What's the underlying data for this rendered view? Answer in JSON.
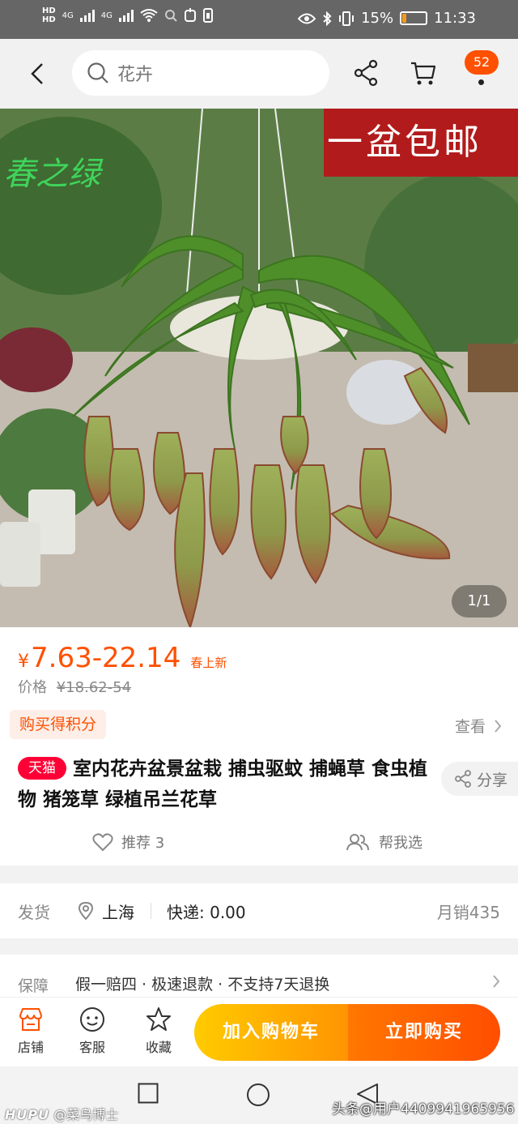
{
  "status_bar": {
    "hd1": "HD",
    "hd2": "HD",
    "net1": "4G",
    "net2": "4G",
    "battery_percent": "15%",
    "battery_level": 0.15,
    "time": "11:33"
  },
  "nav": {
    "search_placeholder": "花卉",
    "cart_badge": "52"
  },
  "hero": {
    "banner_text": "一盆包邮",
    "logo_text": "春之绿",
    "image_counter": "1/1"
  },
  "product": {
    "price_yen": "¥",
    "price": "7.63-22.14",
    "price_tag": "春上新",
    "orig_label": "价格",
    "orig_price": "¥18.62-54",
    "points_label": "购买得积分",
    "look_label": "查看",
    "tmall_badge": "天猫",
    "title": "室内花卉盆景盆栽 捕虫驱蚊 捕蝇草 食虫植物 猪笼草 绿植吊兰花草",
    "share_label": "分享",
    "recommend_label": "推荐 3",
    "help_choose_label": "帮我选"
  },
  "shipping": {
    "label": "发货",
    "location": "上海",
    "fee": "快递: 0.00",
    "monthly_sales": "月销435"
  },
  "guarantee": {
    "label": "保障",
    "value": "假一赔四 · 极速退款 · 不支持7天退换"
  },
  "action_bar": {
    "shop": "店铺",
    "service": "客服",
    "favorite": "收藏",
    "add_to_cart": "加入购物车",
    "buy_now": "立即购买"
  },
  "watermark": {
    "left_brand": "HUPU",
    "left_user": "@菜鸟博士",
    "right": "头条@用户4409941965956"
  },
  "colors": {
    "accent": "#ff5000",
    "tmall": "#ff0036",
    "cart_btn": "#ffa800",
    "buy_btn": "#ff5a00"
  }
}
